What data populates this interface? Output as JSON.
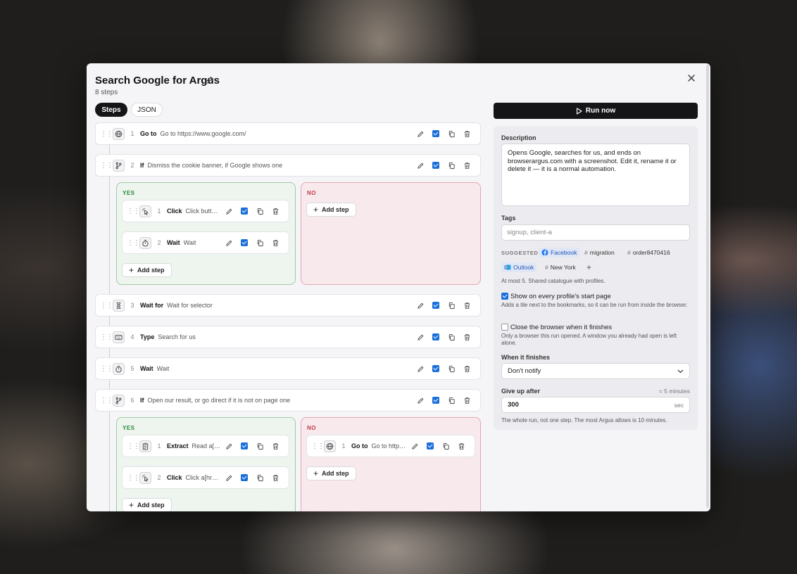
{
  "modal": {
    "title": "Search Google for Argus",
    "subtitle": "8 steps",
    "tabs": [
      {
        "label": "Steps",
        "active": true
      },
      {
        "label": "JSON",
        "active": false
      }
    ]
  },
  "steps": [
    {
      "num": "1",
      "kind": "Go to",
      "detail": "Go to https://www.google.com/",
      "icon": "globe-icon"
    },
    {
      "num": "2",
      "kind": "If",
      "detail": "Dismiss the cookie banner, if Google shows one",
      "icon": "branch-icon",
      "yes": [
        {
          "num": "1",
          "kind": "Click",
          "detail": "Click button…",
          "icon": "pointer-icon"
        },
        {
          "num": "2",
          "kind": "Wait",
          "detail": "Wait",
          "icon": "stopwatch-icon"
        }
      ],
      "no": []
    },
    {
      "num": "3",
      "kind": "Wait for",
      "detail": "Wait for selector",
      "icon": "hourglass-icon"
    },
    {
      "num": "4",
      "kind": "Type",
      "detail": "Search for us",
      "icon": "keyboard-icon"
    },
    {
      "num": "5",
      "kind": "Wait",
      "detail": "Wait",
      "icon": "stopwatch-icon"
    },
    {
      "num": "6",
      "kind": "If",
      "detail": "Open our result, or go direct if it is not on page one",
      "icon": "branch-icon",
      "yes": [
        {
          "num": "1",
          "kind": "Extract",
          "detail": "Read a[hr…",
          "icon": "clipboard-icon"
        },
        {
          "num": "2",
          "kind": "Click",
          "detail": "Click a[href*…",
          "icon": "pointer-icon"
        }
      ],
      "no": [
        {
          "num": "1",
          "kind": "Go to",
          "detail": "Go to https:/…",
          "icon": "globe-icon"
        }
      ]
    }
  ],
  "branch_labels": {
    "yes": "YES",
    "no": "NO"
  },
  "add_step_label": "Add step",
  "run_now_label": "Run now",
  "details": {
    "description_label": "Description",
    "description": "Opens Google, searches for us, and ends on browserargus.com with a screenshot. Edit it, rename it or delete it — it is a normal automation.",
    "tags_label": "Tags",
    "tags_placeholder": "signup, client-a",
    "suggested_label": "SUGGESTED",
    "suggested_tags": [
      {
        "label": "Facebook",
        "icon": "facebook-icon"
      },
      {
        "label": "migration",
        "icon": "hash-icon"
      },
      {
        "label": "order8470416",
        "icon": "hash-icon"
      },
      {
        "label": "Outlook",
        "icon": "outlook-icon"
      },
      {
        "label": "New York",
        "icon": "hash-icon"
      }
    ],
    "tags_hint": "At most 5. Shared catalogue with profiles.",
    "show_start_page": {
      "label": "Show on every profile's start page",
      "checked": true,
      "hint": "Adds a tile next to the bookmarks, so it can be run from inside the browser."
    },
    "close_browser": {
      "label": "Close the browser when it finishes",
      "checked": false,
      "hint": "Only a browser this run opened. A window you already had open is left alone."
    },
    "when_finishes_label": "When it finishes",
    "when_finishes_value": "Don't notify",
    "give_up_label": "Give up after",
    "give_up_equiv": "= 5 minutes",
    "give_up_value": "300",
    "give_up_unit": "sec",
    "give_up_hint": "The whole run, not one step. The most Argus allows is 10 minutes."
  },
  "colors": {
    "checkbox": "#1a6fd9",
    "yes_border": "#9fcca5",
    "no_border": "#e4a7b0",
    "primary_button": "#151518"
  }
}
